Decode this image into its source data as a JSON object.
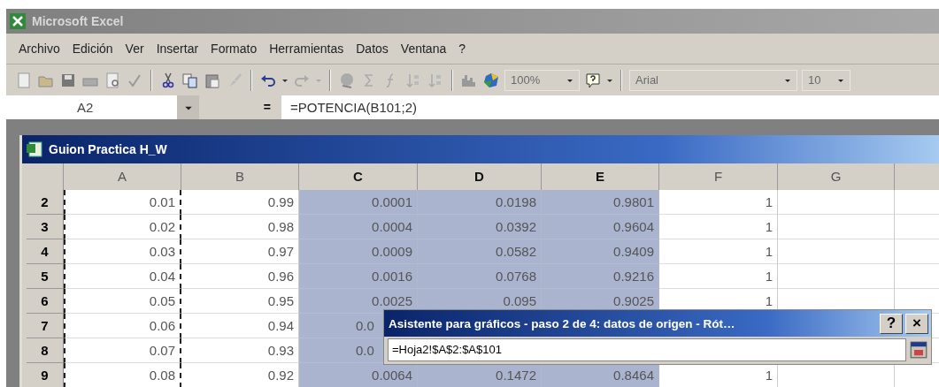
{
  "app": {
    "title": "Microsoft Excel"
  },
  "menu": [
    "Archivo",
    "Edición",
    "Ver",
    "Insertar",
    "Formato",
    "Herramientas",
    "Datos",
    "Ventana",
    "?"
  ],
  "toolbar": {
    "zoom": "100%",
    "font": "Arial",
    "size": "10"
  },
  "formula_bar": {
    "cell": "A2",
    "equals": "=",
    "formula": "=POTENCIA(B101;2)"
  },
  "workbook": {
    "title": "Guion Practica H_W",
    "columns": [
      {
        "label": "A",
        "selected": false,
        "marquee": true
      },
      {
        "label": "B",
        "selected": false,
        "marquee": false
      },
      {
        "label": "C",
        "selected": true,
        "marquee": false
      },
      {
        "label": "D",
        "selected": true,
        "marquee": false
      },
      {
        "label": "E",
        "selected": true,
        "marquee": false
      },
      {
        "label": "F",
        "selected": false,
        "marquee": false
      },
      {
        "label": "G",
        "selected": false,
        "marquee": false
      }
    ],
    "rows": [
      {
        "label": "2",
        "cut": false,
        "cells": [
          "0.01",
          "0.99",
          "0.0001",
          "0.0198",
          "0.9801",
          "1"
        ]
      },
      {
        "label": "3",
        "cut": false,
        "cells": [
          "0.02",
          "0.98",
          "0.0004",
          "0.0392",
          "0.9604",
          "1"
        ]
      },
      {
        "label": "4",
        "cut": false,
        "cells": [
          "0.03",
          "0.97",
          "0.0009",
          "0.0582",
          "0.9409",
          "1"
        ]
      },
      {
        "label": "5",
        "cut": false,
        "cells": [
          "0.04",
          "0.96",
          "0.0016",
          "0.0768",
          "0.9216",
          "1"
        ]
      },
      {
        "label": "6",
        "cut": false,
        "cells": [
          "0.05",
          "0.95",
          "0.0025",
          "0.095",
          "0.9025",
          "1"
        ]
      },
      {
        "label": "7",
        "cut": true,
        "cells": [
          "0.06",
          "0.94",
          "0.0"
        ]
      },
      {
        "label": "8",
        "cut": true,
        "cells": [
          "0.07",
          "0.93",
          "0.0"
        ]
      },
      {
        "label": "9",
        "cut": false,
        "cells": [
          "0.08",
          "0.92",
          "0.0064",
          "0.1472",
          "0.8464",
          "1"
        ]
      }
    ]
  },
  "dialog": {
    "title": "Asistente para gráficos - paso 2 de 4: datos de origen - Rót…",
    "help": "?",
    "close": "×",
    "range": "=Hoja2!$A$2:$A$101"
  }
}
